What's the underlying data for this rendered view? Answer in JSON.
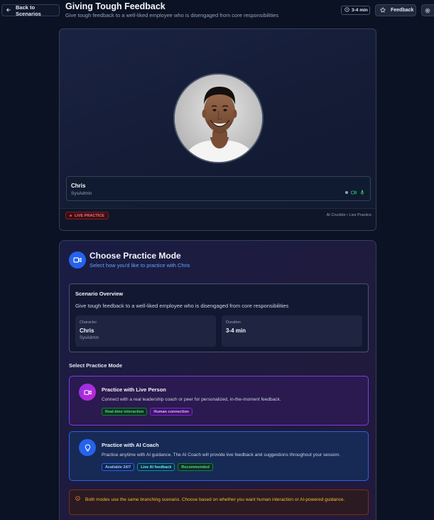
{
  "header": {
    "back_label": "Back to Scenarios",
    "title": "Giving Tough Feedback",
    "subtitle": "Give tough feedback to a well-liked employee who is disengaged from core responsibilities",
    "duration": "3-4 min",
    "feedback_label": "Feedback"
  },
  "video": {
    "name": "Chris",
    "role": "SysAdmin",
    "live_badge": "LIVE PRACTICE",
    "meta": "AI Crucible • Live Practice"
  },
  "mode": {
    "title": "Choose Practice Mode",
    "subtitle": "Select how you'd like to practice with Chris",
    "overview": {
      "heading": "Scenario Overview",
      "description": "Give tough feedback to a well-liked employee who is disengaged from core responsibilities",
      "character_label": "Character",
      "character_name": "Chris",
      "character_role": "SysAdmin",
      "duration_label": "Duration",
      "duration_value": "3-4 min"
    },
    "select_label": "Select Practice Mode",
    "options": [
      {
        "title": "Practice with Live Person",
        "description": "Connect with a real leadership coach or peer for personalized, in-the-moment feedback.",
        "tags": [
          "Real-time interaction",
          "Human connection"
        ]
      },
      {
        "title": "Practice with AI Coach",
        "description": "Practice anytime with AI guidance. The AI Coach will provide live feedback and suggestions throughout your session.",
        "tags": [
          "Available 24/7",
          "Live AI feedback",
          "Recommended"
        ]
      }
    ],
    "note": "Both modes use the same branching scenario. Choose based on whether you want human interaction or AI-powered guidance."
  },
  "colors": {
    "background": "#0b1224",
    "accent_blue": "#2563eb",
    "accent_purple": "#9333ea",
    "live_red": "#ef4444",
    "warning_amber": "#fbbf24"
  }
}
